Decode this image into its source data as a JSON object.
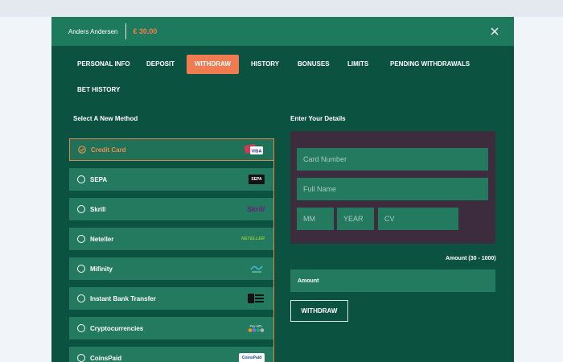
{
  "header": {
    "user_name": "Anders Andersen",
    "balance": "€ 30.00"
  },
  "tabs": [
    {
      "label": "PERSONAL INFO"
    },
    {
      "label": "DEPOSIT"
    },
    {
      "label": "WITHDRAW",
      "active": true
    },
    {
      "label": "HISTORY"
    },
    {
      "label": "BONUSES"
    },
    {
      "label": "LIMITS"
    },
    {
      "label": "PENDING WITHDRAWALS"
    },
    {
      "label": "BET HISTORY"
    }
  ],
  "methods_title": "Select A New Method",
  "methods": [
    {
      "label": "Credit Card",
      "selected": true,
      "logo": "visa-logo"
    },
    {
      "label": "SEPA",
      "logo": "sepa-logo"
    },
    {
      "label": "Skrill",
      "logo": "skrill-logo"
    },
    {
      "label": "Neteller",
      "logo": "neteller-logo"
    },
    {
      "label": "Mifinity",
      "logo": "mifinity-logo"
    },
    {
      "label": "Instant Bank Transfer",
      "logo": "direct-bank-logo"
    },
    {
      "label": "Cryptocurrencies",
      "logo": "crypto-logo"
    },
    {
      "label": "CoinsPaid",
      "logo": "coinspaid-logo"
    }
  ],
  "logos": {
    "visa": "VISA",
    "sepa": "SEPA",
    "skrill": "Skrill",
    "neteller": "NETELLER",
    "coinspaid": "CoinsPaid",
    "crypto": "Pay with"
  },
  "details_title": "Enter Your Details",
  "card_fields": {
    "card_number_placeholder": "Card Number",
    "full_name_placeholder": "Full Name",
    "mm_placeholder": "MM",
    "year_placeholder": "YEAR",
    "cv_placeholder": "CV"
  },
  "amount": {
    "range_label": "Amount (30 - 1000)",
    "field_label": "Amount"
  },
  "withdraw_button": "WITHDRAW",
  "colors": {
    "accent": "#f17b50",
    "panel": "#0c5240",
    "header": "#1d7a5c",
    "method": "#237a5e",
    "card_panel": "#3c2c3e"
  }
}
